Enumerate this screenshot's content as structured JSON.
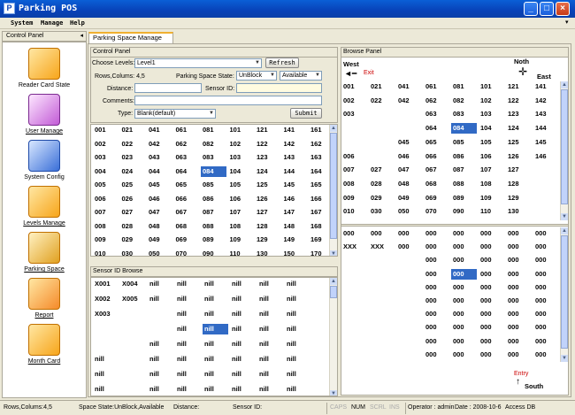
{
  "window": {
    "title": "Parking POS",
    "icon": "P"
  },
  "menu": [
    "System",
    "Manage",
    "Help"
  ],
  "sidebar": {
    "header": "Control Panel",
    "collapse_icon": "◂",
    "items": [
      {
        "label": "Reader Card State",
        "icon": "cards-icon"
      },
      {
        "label": "User Manage",
        "icon": "users-icon"
      },
      {
        "label": "System Config",
        "icon": "config-icon"
      },
      {
        "label": "Levels Manage",
        "icon": "levels-icon"
      },
      {
        "label": "Parking Space",
        "icon": "parking-icon"
      },
      {
        "label": "Report",
        "icon": "report-icon"
      },
      {
        "label": "Month Card",
        "icon": "card-icon"
      }
    ]
  },
  "tab": {
    "label": "Parking Space Manage"
  },
  "control_panel": {
    "title": "Control Panel",
    "choose_levels_label": "Choose Levels:",
    "level_value": "Level1",
    "refresh_label": "Refresh",
    "rows_columns": "Rows,Colums: 4,5",
    "space_state_label": "Parking Space State:",
    "state_value": "UnBlock",
    "avail_value": "Available",
    "distance_label": "Distance:",
    "sensor_id_label": "Sensor ID:",
    "comments_label": "Comments:",
    "type_label": "Type:",
    "type_value": "Blank(default)",
    "submit_label": "Submit"
  },
  "space_grid": {
    "rows": [
      [
        "001",
        "021",
        "041",
        "061",
        "081",
        "101",
        "121",
        "141",
        "161"
      ],
      [
        "002",
        "022",
        "042",
        "062",
        "082",
        "102",
        "122",
        "142",
        "162"
      ],
      [
        "003",
        "023",
        "043",
        "063",
        "083",
        "103",
        "123",
        "143",
        "163"
      ],
      [
        "004",
        "024",
        "044",
        "064",
        "084",
        "104",
        "124",
        "144",
        "164"
      ],
      [
        "005",
        "025",
        "045",
        "065",
        "085",
        "105",
        "125",
        "145",
        "165"
      ],
      [
        "006",
        "026",
        "046",
        "066",
        "086",
        "106",
        "126",
        "146",
        "166"
      ],
      [
        "007",
        "027",
        "047",
        "067",
        "087",
        "107",
        "127",
        "147",
        "167"
      ],
      [
        "008",
        "028",
        "048",
        "068",
        "088",
        "108",
        "128",
        "148",
        "168"
      ],
      [
        "009",
        "029",
        "049",
        "069",
        "089",
        "109",
        "129",
        "149",
        "169"
      ],
      [
        "010",
        "030",
        "050",
        "070",
        "090",
        "110",
        "130",
        "150",
        "170"
      ]
    ]
  },
  "sensor_browse": {
    "title": "Sensor ID Browse",
    "rows": [
      [
        "X001",
        "X004",
        "nill",
        "nill",
        "nill",
        "nill",
        "nill",
        "nill"
      ],
      [
        "X002",
        "X005",
        "nill",
        "nill",
        "nill",
        "nill",
        "nill",
        "nill"
      ],
      [
        "X003",
        "",
        "",
        "nill",
        "nill",
        "nill",
        "nill",
        "nill"
      ],
      [
        "",
        "",
        "",
        "nill",
        "nill",
        "nill",
        "nill",
        "nill"
      ],
      [
        "",
        "",
        "nill",
        "nill",
        "nill",
        "nill",
        "nill",
        "nill"
      ],
      [
        "nill",
        "",
        "nill",
        "nill",
        "nill",
        "nill",
        "nill",
        "nill"
      ],
      [
        "nill",
        "",
        "nill",
        "nill",
        "nill",
        "nill",
        "nill",
        "nill"
      ],
      [
        "nill",
        "",
        "nill",
        "nill",
        "nill",
        "nill",
        "nill",
        "nill"
      ]
    ]
  },
  "browse_panel": {
    "title": "Browse Panel",
    "west": "West",
    "exit": "Exit",
    "north": "Noth",
    "east": "East",
    "entry": "Entry",
    "south": "South",
    "rows": [
      [
        "001",
        "021",
        "041",
        "061",
        "081",
        "101",
        "121",
        "141"
      ],
      [
        "002",
        "022",
        "042",
        "062",
        "082",
        "102",
        "122",
        "142"
      ],
      [
        "003",
        "",
        "",
        "063",
        "083",
        "103",
        "123",
        "143"
      ],
      [
        "",
        "",
        "",
        "064",
        "084",
        "104",
        "124",
        "144"
      ],
      [
        "",
        "",
        "045",
        "065",
        "085",
        "105",
        "125",
        "145"
      ],
      [
        "006",
        "",
        "046",
        "066",
        "086",
        "106",
        "126",
        "146"
      ],
      [
        "007",
        "027",
        "047",
        "067",
        "087",
        "107",
        "127",
        ""
      ],
      [
        "008",
        "028",
        "048",
        "068",
        "088",
        "108",
        "128",
        ""
      ],
      [
        "009",
        "029",
        "049",
        "069",
        "089",
        "109",
        "129",
        ""
      ],
      [
        "010",
        "030",
        "050",
        "070",
        "090",
        "110",
        "130",
        ""
      ]
    ],
    "sensor_rows": [
      [
        "000",
        "000",
        "000",
        "000",
        "000",
        "000",
        "000",
        "000"
      ],
      [
        "XXX",
        "XXX",
        "000",
        "000",
        "000",
        "000",
        "000",
        "000"
      ],
      [
        "",
        "",
        "",
        "000",
        "000",
        "000",
        "000",
        "000"
      ],
      [
        "",
        "",
        "",
        "000",
        "000",
        "000",
        "000",
        "000"
      ],
      [
        "",
        "",
        "",
        "000",
        "000",
        "000",
        "000",
        "000"
      ],
      [
        "",
        "",
        "",
        "000",
        "000",
        "000",
        "000",
        "000"
      ],
      [
        "",
        "",
        "",
        "000",
        "000",
        "000",
        "000",
        "000"
      ],
      [
        "",
        "",
        "",
        "000",
        "000",
        "000",
        "000",
        "000"
      ],
      [
        "",
        "",
        "",
        "000",
        "000",
        "000",
        "000",
        "000"
      ],
      [
        "",
        "",
        "",
        "000",
        "000",
        "000",
        "000",
        "000"
      ]
    ]
  },
  "statusbar": {
    "rows_cols": "Rows,Colums:4,5",
    "space_state": "Space State:UnBlock,Available",
    "distance": "Distance:",
    "sensor_id": "Sensor ID:",
    "caps": "CAPS",
    "num": "NUM",
    "scrl": "SCRL",
    "ins": "INS",
    "operator": "Operator : admin",
    "date": "Date : 2008-10-6",
    "db": "Access DB"
  },
  "colors": {
    "titlebar": "#0842b8",
    "selection": "#316ac5",
    "exit": "#cc0000"
  }
}
